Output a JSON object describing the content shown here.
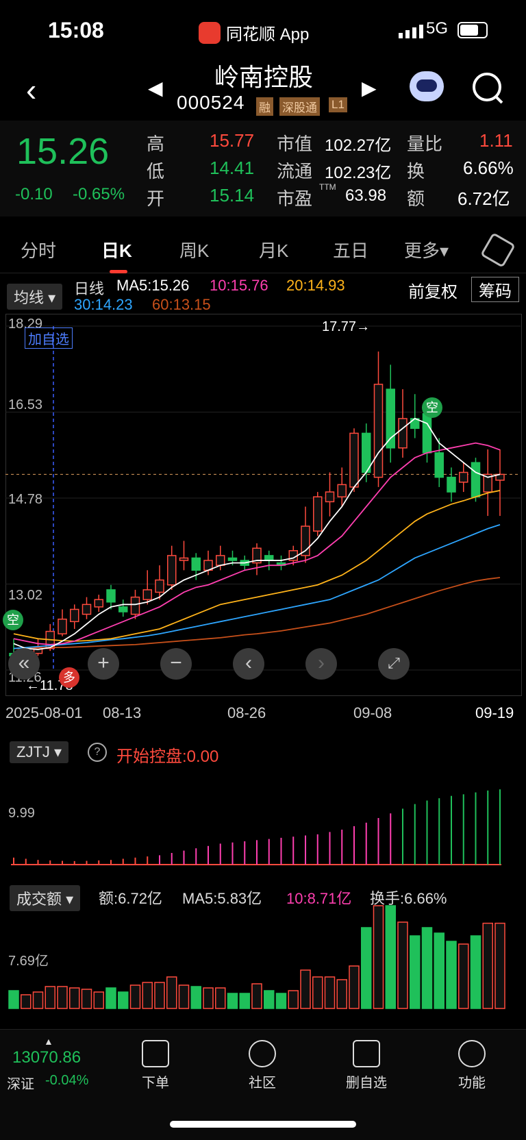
{
  "status_bar": {
    "time": "15:08",
    "app": "同花顺 App",
    "network": "5G"
  },
  "header": {
    "name": "岭南控股",
    "code": "000524",
    "tags": [
      "融",
      "深股通",
      "L1"
    ]
  },
  "quote": {
    "price": "15.26",
    "change": "-0.10",
    "change_pct": "-0.65%",
    "high_label": "高",
    "high": "15.77",
    "low_label": "低",
    "low": "14.41",
    "open_label": "开",
    "open": "15.14",
    "mktcap_label": "市值",
    "mktcap": "102.27亿",
    "float_label": "流通",
    "float": "102.23亿",
    "pe_label": "市盈",
    "pe_sup": "TTM",
    "pe": "63.98",
    "vr_label": "量比",
    "vr": "1.11",
    "turn_label": "换",
    "turn": "6.66%",
    "amt_label": "额",
    "amt": "6.72亿"
  },
  "tabs": [
    "分时",
    "日K",
    "周K",
    "月K",
    "五日",
    "更多▾"
  ],
  "ma_bar": {
    "selector": "均线",
    "type": "日线",
    "ma5": "MA5:15.26",
    "ma10": "10:15.76",
    "ma20": "20:14.93",
    "ma30": "30:14.23",
    "ma60": "60:13.15",
    "adjust": "前复权",
    "chips": "筹码",
    "colors": {
      "ma5": "#ffffff",
      "ma10": "#ff3fb0",
      "ma20": "#ffb31a",
      "ma30": "#2ea6ff",
      "ma60": "#c8501a"
    }
  },
  "kchart": {
    "y_labels": [
      "18.29",
      "16.53",
      "14.78",
      "13.02",
      "11.26"
    ],
    "add_watch": "加自选",
    "high_mark": "17.77",
    "low_mark": "11.78",
    "dates": [
      "2025-08-01",
      "08-13",
      "08-26",
      "09-08",
      "09-19"
    ],
    "kong": "空",
    "duo": "多"
  },
  "zjtj": {
    "selector": "ZJTJ",
    "help": "?",
    "text": "开始控盘:0.00",
    "y_label": "9.99"
  },
  "volume": {
    "selector": "成交额",
    "amt": "额:6.72亿",
    "ma5": "MA5:5.83亿",
    "ma10": "10:8.71亿",
    "turn": "换手:6.66%",
    "y_label": "7.69亿"
  },
  "bottom": {
    "index_value": "13070.86",
    "index_name": "深证",
    "index_chg": "-0.04%",
    "items": [
      {
        "label": "下单",
        "icon": "order-icon"
      },
      {
        "label": "社区",
        "icon": "community-icon"
      },
      {
        "label": "删自选",
        "icon": "remove-watch-icon"
      },
      {
        "label": "功能",
        "icon": "menu-icon"
      }
    ]
  },
  "chart_data": {
    "type": "candlestick",
    "x_range": [
      "2025-08-01",
      "2025-09-19"
    ],
    "ylim": [
      11.26,
      18.29
    ],
    "candles": [
      [
        11.6,
        11.55,
        11.9,
        11.5
      ],
      [
        11.5,
        11.6,
        11.7,
        11.45
      ],
      [
        11.6,
        11.72,
        11.9,
        11.55
      ],
      [
        11.7,
        12.05,
        12.2,
        11.65
      ],
      [
        12.0,
        12.3,
        12.5,
        11.95
      ],
      [
        12.25,
        12.5,
        12.6,
        12.1
      ],
      [
        12.4,
        12.6,
        12.75,
        12.3
      ],
      [
        12.55,
        12.7,
        12.8,
        12.45
      ],
      [
        12.9,
        12.65,
        13.0,
        12.5
      ],
      [
        12.55,
        12.45,
        12.7,
        12.35
      ],
      [
        12.4,
        12.75,
        12.9,
        12.3
      ],
      [
        12.7,
        12.9,
        13.3,
        12.6
      ],
      [
        12.85,
        13.1,
        13.4,
        12.7
      ],
      [
        13.0,
        13.6,
        13.8,
        12.9
      ],
      [
        13.5,
        13.55,
        13.9,
        13.3
      ],
      [
        13.55,
        13.3,
        13.65,
        13.1
      ],
      [
        13.3,
        13.5,
        13.7,
        13.2
      ],
      [
        13.4,
        13.6,
        13.8,
        13.3
      ],
      [
        13.55,
        13.5,
        13.7,
        13.4
      ],
      [
        13.5,
        13.4,
        13.6,
        13.3
      ],
      [
        13.45,
        13.75,
        13.85,
        13.2
      ],
      [
        13.6,
        13.5,
        13.7,
        13.3
      ],
      [
        13.45,
        13.4,
        13.6,
        13.3
      ],
      [
        13.5,
        13.7,
        13.8,
        13.4
      ],
      [
        13.6,
        14.2,
        14.6,
        13.45
      ],
      [
        14.1,
        14.8,
        14.9,
        14.0
      ],
      [
        14.7,
        14.9,
        15.3,
        14.4
      ],
      [
        14.8,
        15.05,
        15.4,
        14.6
      ],
      [
        15.0,
        16.1,
        16.2,
        14.9
      ],
      [
        16.1,
        15.3,
        16.3,
        15.1
      ],
      [
        15.2,
        17.1,
        17.77,
        15.0
      ],
      [
        17.0,
        15.8,
        17.5,
        15.5
      ],
      [
        15.8,
        16.4,
        17.0,
        15.6
      ],
      [
        16.4,
        16.2,
        16.9,
        16.0
      ],
      [
        16.5,
        15.7,
        16.7,
        15.5
      ],
      [
        15.7,
        15.2,
        16.0,
        15.0
      ],
      [
        15.2,
        14.9,
        15.4,
        14.7
      ],
      [
        15.1,
        15.3,
        15.5,
        14.9
      ],
      [
        15.5,
        14.8,
        15.6,
        14.7
      ],
      [
        14.9,
        15.26,
        15.77,
        14.41
      ],
      [
        15.14,
        15.26,
        15.77,
        14.41
      ]
    ],
    "ma5": [
      11.8,
      11.7,
      11.68,
      11.72,
      11.85,
      12.0,
      12.2,
      12.4,
      12.55,
      12.6,
      12.6,
      12.65,
      12.75,
      12.95,
      13.1,
      13.2,
      13.3,
      13.4,
      13.45,
      13.45,
      13.5,
      13.5,
      13.5,
      13.55,
      13.7,
      13.95,
      14.3,
      14.6,
      15.0,
      15.3,
      15.7,
      16.0,
      16.2,
      16.4,
      16.3,
      15.9,
      15.7,
      15.5,
      15.3,
      15.2,
      15.26
    ],
    "ma10": [
      11.9,
      11.85,
      11.8,
      11.78,
      11.8,
      11.85,
      11.95,
      12.05,
      12.15,
      12.25,
      12.35,
      12.45,
      12.55,
      12.7,
      12.85,
      12.95,
      13.0,
      13.1,
      13.2,
      13.3,
      13.35,
      13.4,
      13.4,
      13.45,
      13.5,
      13.6,
      13.8,
      14.0,
      14.3,
      14.6,
      14.9,
      15.2,
      15.4,
      15.6,
      15.7,
      15.75,
      15.8,
      15.85,
      15.9,
      15.85,
      15.76
    ],
    "ma20": [
      12.0,
      11.95,
      11.9,
      11.88,
      11.86,
      11.85,
      11.86,
      11.88,
      11.9,
      11.95,
      12.0,
      12.05,
      12.1,
      12.2,
      12.3,
      12.4,
      12.5,
      12.6,
      12.65,
      12.7,
      12.75,
      12.8,
      12.85,
      12.9,
      12.95,
      13.0,
      13.1,
      13.2,
      13.35,
      13.5,
      13.7,
      13.9,
      14.1,
      14.3,
      14.45,
      14.55,
      14.65,
      14.72,
      14.8,
      14.88,
      14.93
    ],
    "ma30": [
      11.7,
      11.72,
      11.74,
      11.76,
      11.78,
      11.8,
      11.82,
      11.85,
      11.88,
      11.9,
      11.93,
      11.96,
      12.0,
      12.05,
      12.1,
      12.15,
      12.2,
      12.25,
      12.3,
      12.35,
      12.4,
      12.45,
      12.5,
      12.55,
      12.6,
      12.65,
      12.7,
      12.8,
      12.9,
      13.0,
      13.1,
      13.25,
      13.4,
      13.55,
      13.65,
      13.75,
      13.85,
      13.95,
      14.05,
      14.15,
      14.23
    ],
    "ma60": [
      11.7,
      11.7,
      11.71,
      11.72,
      11.72,
      11.73,
      11.74,
      11.75,
      11.76,
      11.77,
      11.78,
      11.8,
      11.82,
      11.84,
      11.86,
      11.88,
      11.9,
      11.92,
      11.95,
      11.98,
      12.0,
      12.03,
      12.06,
      12.1,
      12.14,
      12.18,
      12.22,
      12.28,
      12.34,
      12.4,
      12.48,
      12.56,
      12.64,
      12.72,
      12.8,
      12.88,
      12.95,
      13.02,
      13.08,
      13.12,
      13.15
    ]
  }
}
